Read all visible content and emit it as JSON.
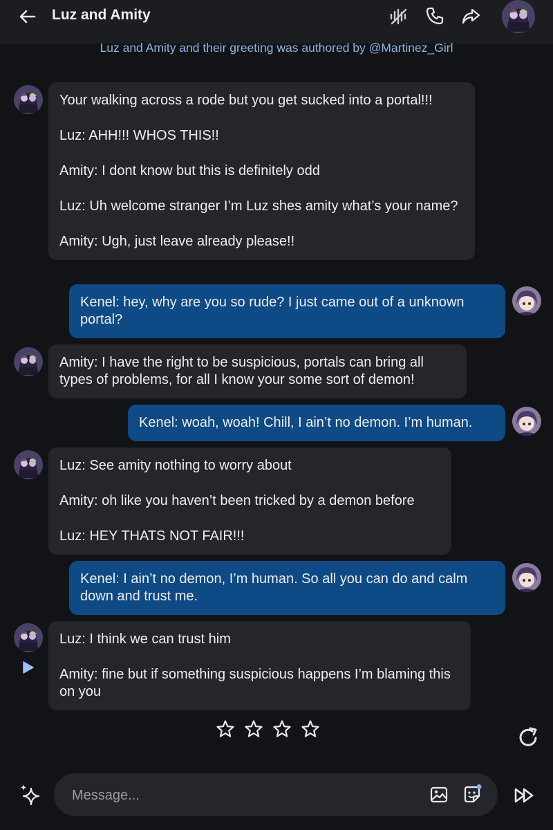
{
  "header": {
    "title": "Luz and Amity",
    "credit": "Luz and Amity and their greeting was authored by @Martinez_Girl"
  },
  "icons": {
    "back": "arrow-left-icon",
    "voice": "voice-off-icon",
    "call": "phone-icon",
    "share": "share-icon",
    "play": "play-icon",
    "star": "star-outline-icon",
    "regenerate": "refresh-icon",
    "suggest": "sparkle-icon",
    "image": "image-icon",
    "sticker": "sticker-icon",
    "send": "fast-forward-icon"
  },
  "messages": [
    {
      "role": "bot",
      "lines": [
        "Your walking across a rode but you get sucked into a portal!!!",
        "Luz: AHH!!! WHOS THIS!!",
        "Amity: I dont know but this is definitely odd",
        "Luz: Uh welcome stranger I’m Luz shes amity what’s your name?",
        "Amity: Ugh, just leave already please!!"
      ]
    },
    {
      "role": "user",
      "lines": [
        "Kenel: hey, why are you so rude? I just came out of a unknown portal?"
      ]
    },
    {
      "role": "bot",
      "lines": [
        "Amity: I have the right to be suspicious, portals can bring all types of problems, for all I know your some sort of demon!"
      ]
    },
    {
      "role": "user",
      "lines": [
        "Kenel: woah, woah! Chill, I ain’t no demon. I’m human."
      ]
    },
    {
      "role": "bot",
      "lines": [
        "Luz: See amity nothing to worry about",
        "Amity: oh like you haven’t been tricked by a demon before",
        "Luz: HEY THATS NOT FAIR!!!"
      ]
    },
    {
      "role": "user",
      "lines": [
        "Kenel: I ain’t no demon, I’m human. So all you can do and calm down and trust me."
      ]
    },
    {
      "role": "bot",
      "lines": [
        "Luz: I think we can trust him",
        "Amity: fine but if something suspicious happens I’m blaming this on you"
      ]
    }
  ],
  "rating": {
    "max": 4,
    "value": 0
  },
  "composer": {
    "placeholder": "Message..."
  },
  "colors": {
    "background": "#121316",
    "bot_bubble": "#25262c",
    "user_bubble": "#0e4a85",
    "credit_text": "#8fb2e3"
  }
}
